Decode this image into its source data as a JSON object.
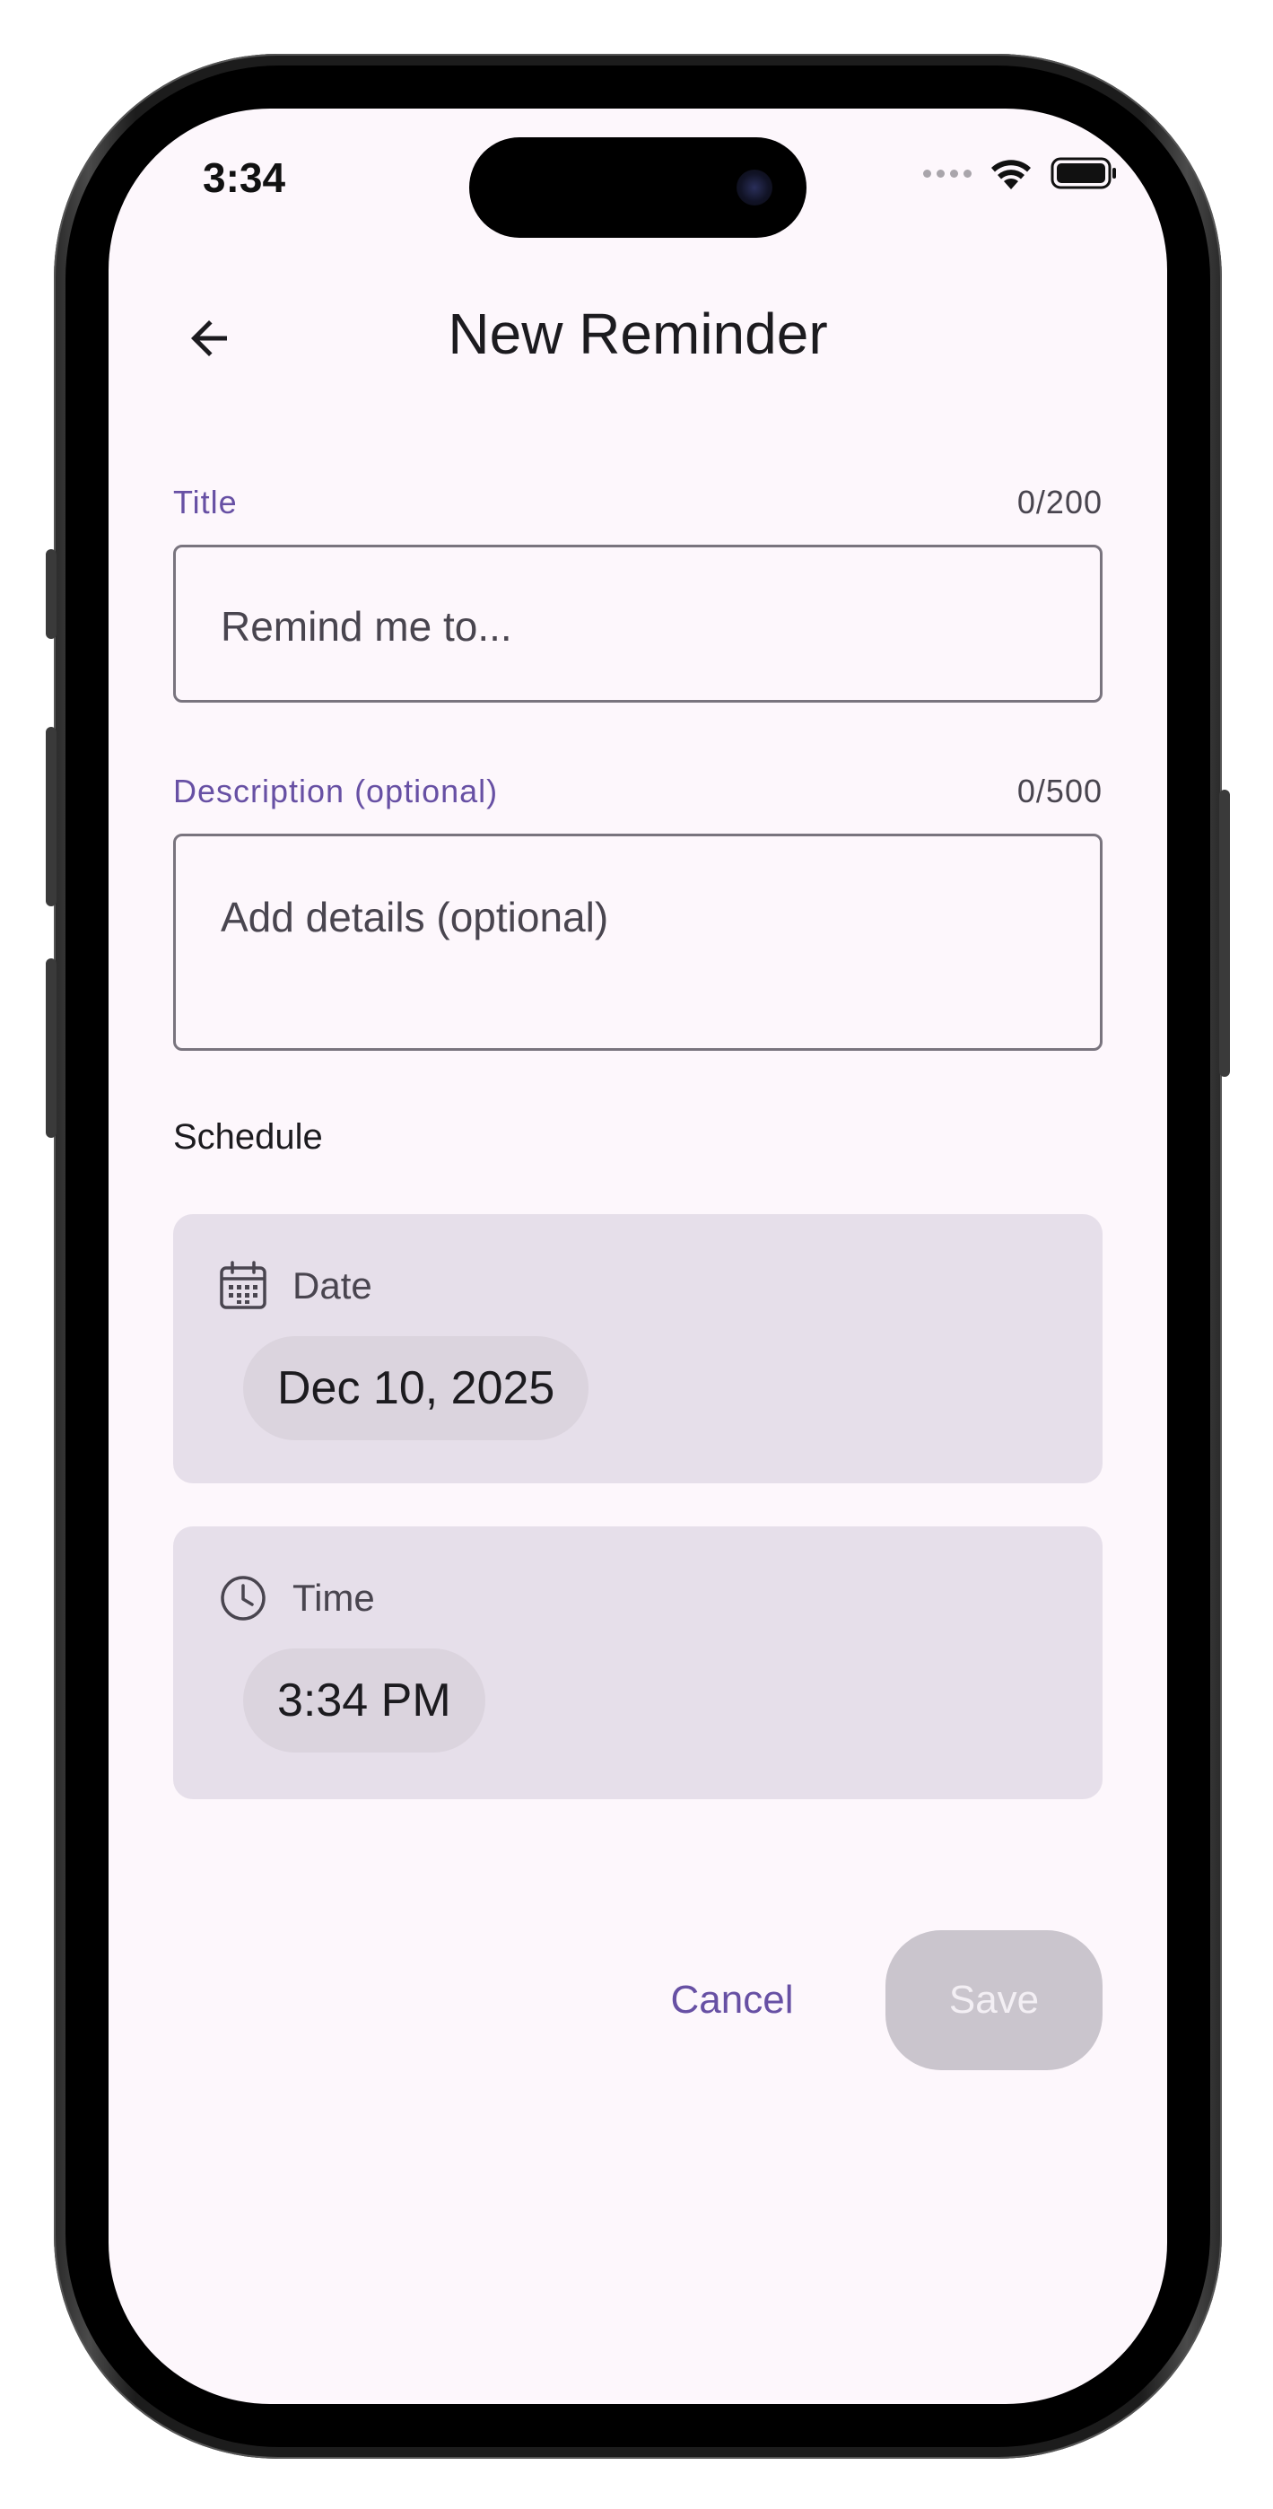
{
  "status_bar": {
    "time": "3:34"
  },
  "header": {
    "title": "New Reminder"
  },
  "form": {
    "title": {
      "label": "Title",
      "counter": "0/200",
      "value": "",
      "placeholder": "Remind me to..."
    },
    "description": {
      "label": "Description (optional)",
      "counter": "0/500",
      "value": "",
      "placeholder": "Add details (optional)"
    }
  },
  "schedule": {
    "heading": "Schedule",
    "date": {
      "label": "Date",
      "value": "Dec 10, 2025",
      "icon": "calendar-icon"
    },
    "time": {
      "label": "Time",
      "value": "3:34 PM",
      "icon": "clock-icon"
    }
  },
  "actions": {
    "cancel_label": "Cancel",
    "save_label": "Save",
    "save_enabled": false
  },
  "colors": {
    "accent": "#6750a4",
    "background": "#fdf7fc",
    "card": "#e6dfea",
    "chip": "#dbd4de",
    "save_disabled": "#cac5cd"
  }
}
